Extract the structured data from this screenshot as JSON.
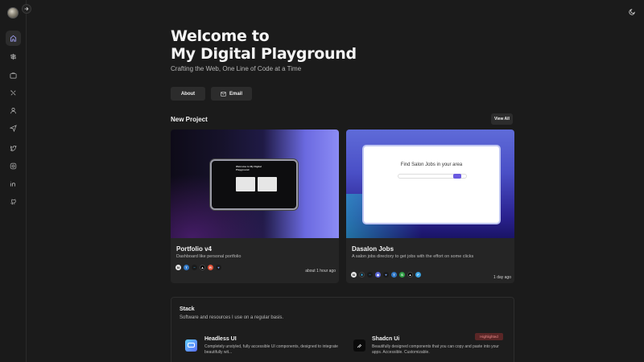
{
  "sidebar": {
    "avatar_label": "",
    "items": [
      {
        "icon": "home-icon"
      },
      {
        "icon": "signpost-icon"
      },
      {
        "icon": "briefcase-icon"
      },
      {
        "icon": "tools-icon"
      },
      {
        "icon": "user-icon"
      },
      {
        "icon": "send-icon"
      },
      {
        "icon": "twitter-icon"
      },
      {
        "icon": "instagram-icon"
      },
      {
        "icon": "linkedin-icon"
      },
      {
        "icon": "github-icon"
      }
    ]
  },
  "hero": {
    "title_line1": "Welcome to",
    "title_line2": "My Digital Playground",
    "subtitle": "Crafting the Web, One Line of Code at a Time",
    "about_label": "About",
    "email_label": "Email"
  },
  "projects": {
    "section_title": "New Project",
    "view_all_label": "View All",
    "items": [
      {
        "name": "Portfolio v4",
        "description": "Dashboard like personal portfolio",
        "time": "about 1 hour ago",
        "mock_title": "Welcome to My Digital Playground"
      },
      {
        "name": "Dasalon Jobs",
        "description": "A salon jobs directory to get jobs with the effort on some clicks",
        "time": "1 day ago",
        "mock_title": "Find Salon Jobs in your area"
      }
    ]
  },
  "stack": {
    "title": "Stack",
    "subtitle": "Software and resources I use on a regular basis.",
    "items": [
      {
        "name": "Headless UI",
        "description": "Completely unstyled, fully accessible UI components, designed to integrate beautifully wit..."
      },
      {
        "name": "Shadcn Ui",
        "description": "Beautifully designed components that you can copy and paste into your apps. Accessible. Customizable.",
        "badge": "Highlighted"
      }
    ]
  },
  "colors": {
    "background": "#1b1b1b",
    "card": "#252525",
    "button": "#2c2c2c",
    "badge_bg": "#5a2626",
    "badge_text": "#e98b8b"
  }
}
